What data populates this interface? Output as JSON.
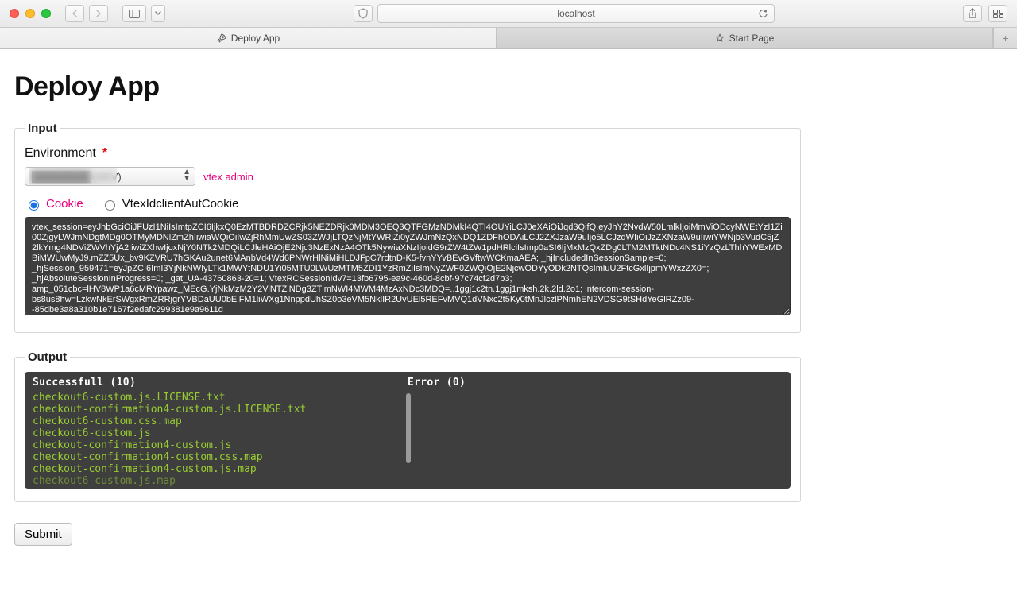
{
  "browser": {
    "url": "localhost",
    "tabs": [
      {
        "label": "Deploy App",
        "active": true,
        "icon": "rocket"
      },
      {
        "label": "Start Page",
        "active": false,
        "icon": "star"
      }
    ]
  },
  "page": {
    "title": "Deploy App",
    "input_legend": "Input",
    "output_legend": "Output",
    "environment": {
      "label": "Environment",
      "required_mark": "*",
      "selected": "████████ (DEV)",
      "admin_link": "vtex admin"
    },
    "auth": {
      "options": [
        "Cookie",
        "VtexIdclientAutCookie"
      ],
      "selected_index": 0,
      "cookie_value": "vtex_session=eyJhbGciOiJFUzI1NiIsImtpZCI6IjkxQ0EzMTBDRDZCRjk5NEZDRjk0MDM3OEQ3QTFGMzNDMkI4QTI4OUYiLCJ0eXAiOiJqd3QifQ.eyJhY2NvdW50LmlkIjoiMmViODcyNWEtYzI1Zi00ZjgyLWJmNDgtMDg0OTMyMDNlZmZhIiwiaWQiOiIwZjRhMmUwZS03ZWJjLTQzNjMtYWRiZi0yZWJmNzQxNDQ1ZDFhODAiLCJ2ZXJzaW9uIjo5LCJzdWIiOiJzZXNzaW9uIiwiYWNjb3VudC5jZ2lkYmg4NDViZWVhYjA2IiwiZXhwIjoxNjY0NTk2MDQiLCJleHAiOjE2Njc3NzExNzA4OTk5NywiaXNzIjoidG9rZW4tZW1pdHRlciIsImp0aSI6IjMxMzQxZDg0LTM2MTktNDc4NS1iYzQzLThhYWExMDBiMWUwMyJ9.mZZ5Ux_bv9KZVRU7hGKAu2unet6MAnbVd4Wd6PNWrHlNiMiHLDJFpC7rdtnD-K5-fvnYYvBEvGVftwWCKmaAEA; _hjIncludedInSessionSample=0; _hjSession_959471=eyJpZCI6ImI3YjNkNWIyLTk1MWYtNDU1Yi05MTU0LWUzMTM5ZDI1YzRmZiIsImNyZWF0ZWQiOjE2NjcwODYyODk2NTQsImluU2FtcGxlIjpmYWxzZX0=; _hjAbsoluteSessionInProgress=0; _gat_UA-43760863-20=1; VtexRCSessionIdv7=13fb6795-ea9c-460d-8cbf-97c74cf2d7b3; amp_051cbc=lHV8WP1a6cMRYpawz_MEcG.YjNkMzM2Y2ViNTZiNDg3ZTlmNWI4MWM4MzAxNDc3MDQ=..1ggj1c2tn.1ggj1mksh.2k.2ld.2o1; intercom-session-bs8us8hw=LzkwNkErSWgxRmZRRjgrYVBDaUU0bElFM1liWXg1NnppdUhSZ0o3eVM5NklIR2UvUEl5REFvMVQ1dVNxc2t5Ky0tMnJlczlPNmhEN2VDSG9tSHdYeGlRZz09--85dbe3a8a310b1e7167f2edafc299381e9a9611d"
    },
    "output": {
      "success_label": "Successfull",
      "success_count": 10,
      "error_label": "Error",
      "error_count": 0,
      "success_files": [
        "checkout6-custom.js.LICENSE.txt",
        "checkout-confirmation4-custom.js.LICENSE.txt",
        "checkout6-custom.css.map",
        "checkout6-custom.js",
        "checkout-confirmation4-custom.js",
        "checkout-confirmation4-custom.css.map",
        "checkout-confirmation4-custom.js.map",
        "checkout6-custom.js.map"
      ],
      "error_files": []
    },
    "submit_label": "Submit"
  }
}
